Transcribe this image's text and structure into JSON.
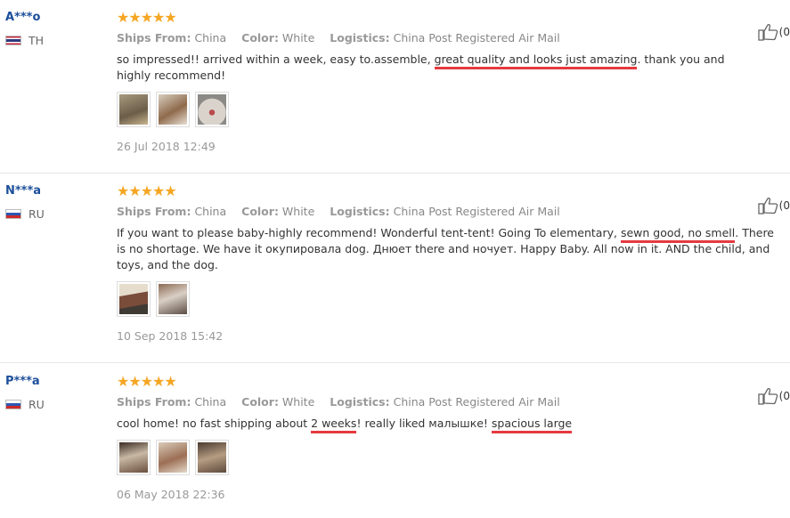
{
  "reviews": [
    {
      "username": "A***o",
      "country": "TH",
      "stars": "★★★★★",
      "ships_from_label": "Ships From:",
      "ships_from": "China",
      "color_label": "Color:",
      "color": "White",
      "logistics_label": "Logistics:",
      "logistics": "China Post Registered Air Mail",
      "text_before": "so impressed!! arrived within a week, easy to.assemble, ",
      "text_highlight": "great quality and looks just amazing",
      "text_after": ". thank you and highly recommend!",
      "date": "26 Jul 2018 12:49",
      "likes": "(0"
    },
    {
      "username": "N***a",
      "country": "RU",
      "stars": "★★★★★",
      "ships_from_label": "Ships From:",
      "ships_from": "China",
      "color_label": "Color:",
      "color": "White",
      "logistics_label": "Logistics:",
      "logistics": "China Post Registered Air Mail",
      "text_before": "If you want to please baby-highly recommend! Wonderful tent-tent! Going To elementary, ",
      "text_highlight": "sewn good, no smell",
      "text_after": ". There is no shortage. We have it окупировала dog. Днюет there and ночует. Happy Baby. All now in it. AND the child, and toys, and the dog.",
      "date": "10 Sep 2018 15:42",
      "likes": "(0"
    },
    {
      "username": "P***a",
      "country": "RU",
      "stars": "★★★★★",
      "ships_from_label": "Ships From:",
      "ships_from": "China",
      "color_label": "Color:",
      "color": "White",
      "logistics_label": "Logistics:",
      "logistics": "China Post Registered Air Mail",
      "text_before": "cool home! no fast shipping about ",
      "text_highlight": "2 weeks",
      "text_middle": "! really liked малышке! ",
      "text_highlight2": "spacious large",
      "date": "06 May 2018 22:36",
      "likes": "(0"
    }
  ],
  "colors": {
    "username": "#1c4f9c",
    "stars": "#f5a623",
    "highlight_underline": "#e53a3f"
  },
  "icons": {
    "like": "thumbs-up-icon"
  }
}
